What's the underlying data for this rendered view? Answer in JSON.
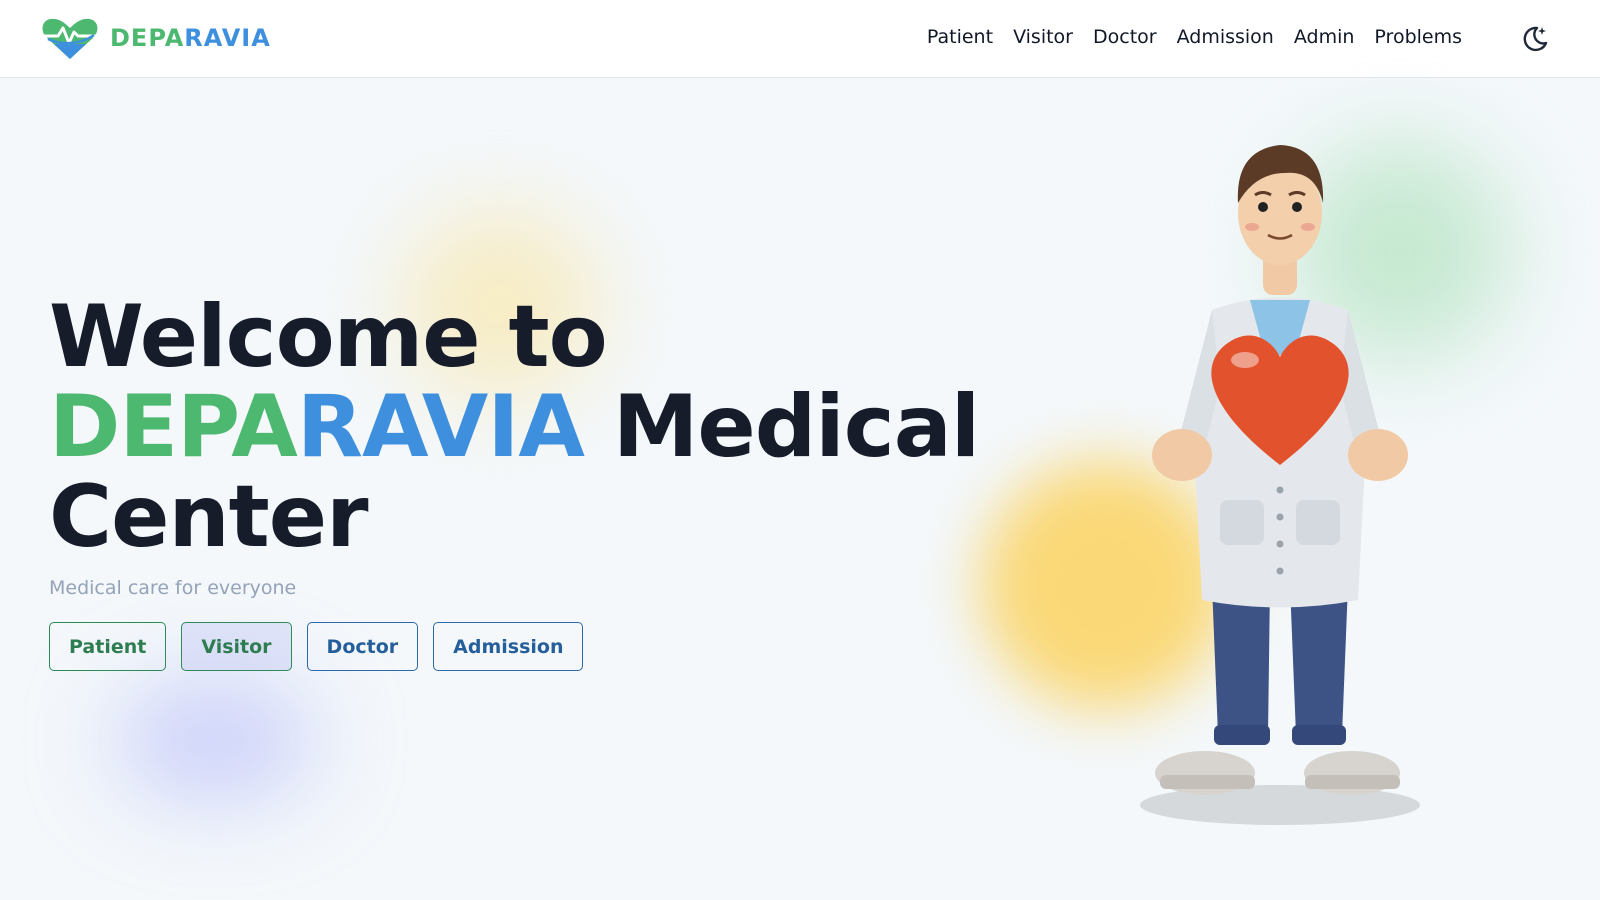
{
  "brand": {
    "name_part1": "DEPA",
    "name_part2": "RAVIA",
    "logo_icon": "heart-pulse-logo-icon"
  },
  "nav": {
    "items": [
      {
        "label": "Patient"
      },
      {
        "label": "Visitor"
      },
      {
        "label": "Doctor"
      },
      {
        "label": "Admission"
      },
      {
        "label": "Admin"
      },
      {
        "label": "Problems"
      }
    ],
    "theme_toggle_icon": "moon-icon"
  },
  "hero": {
    "line1": "Welcome to",
    "brand_part1": "DEPA",
    "brand_part2": "RAVIA",
    "line2_suffix": " Medical",
    "line3": "Center",
    "subtitle": "Medical care for everyone"
  },
  "actions": [
    {
      "label": "Patient"
    },
    {
      "label": "Visitor"
    },
    {
      "label": "Doctor"
    },
    {
      "label": "Admission"
    }
  ],
  "colors": {
    "brand_green": "#4cb870",
    "brand_blue": "#3e90de",
    "heading": "#171c2b",
    "background": "#f4f8fb"
  },
  "illustration": "doctor-holding-heart-illustration"
}
